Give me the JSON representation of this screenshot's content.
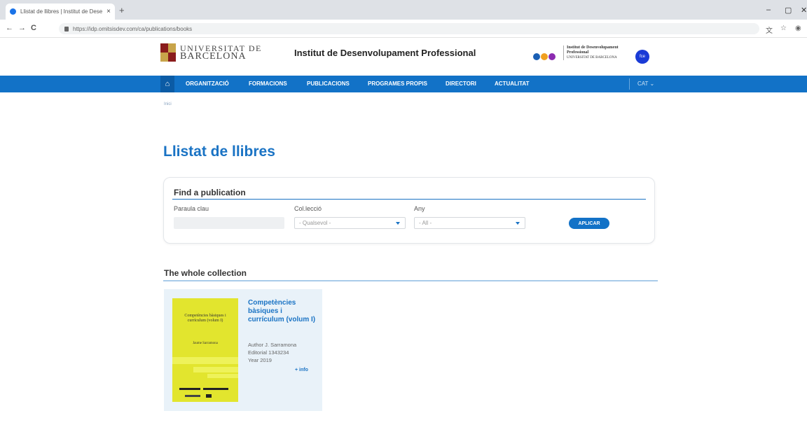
{
  "browser": {
    "tab_title": "Llistat de llibres | Institut de Dese",
    "tab_close": "×",
    "new_tab": "+",
    "url": "https://idp.omitsisdev.com/ca/publications/books",
    "controls": {
      "minimize": "–",
      "maximize": "▢",
      "close": "✕"
    },
    "nav": {
      "back": "←",
      "forward": "→",
      "reload": "C"
    }
  },
  "header": {
    "ub_line1": "UNIVERSITAT DE",
    "ub_line2": "BARCELONA",
    "site_title": "Institut de Desenvolupament Professional",
    "idp_line1": "Institut de Desenvolupament",
    "idp_line2": "Professional",
    "idp_line3": "UNIVERSITAT DE BARCELONA",
    "fce_label": "fce",
    "badge_colors": [
      "#1a5fb4",
      "#f0a020",
      "#8c2bb0"
    ]
  },
  "nav": {
    "home_icon": "⌂",
    "items": [
      "ORGANITZACIÓ",
      "FORMACIONS",
      "PUBLICACIONS",
      "PROGRAMES PROPIS",
      "DIRECTORI",
      "ACTUALITAT"
    ],
    "lang": "CAT ⌄"
  },
  "breadcrumb": "Inici",
  "page_title": "Llistat de llibres",
  "filters": {
    "title": "Find a publication",
    "keyword_label": "Paraula clau",
    "keyword_value": "",
    "collection_label": "Col.lecció",
    "collection_value": "- Qualsevol -",
    "year_label": "Any",
    "year_value": "- All -",
    "apply_label": "APLICAR"
  },
  "collection": {
    "title": "The whole collection",
    "books": [
      {
        "title": "Competències bàsiques i currículum (volum I)",
        "cover_title": "Competències bàsiques i currículum (volum I)",
        "cover_author": "Jaume Sarramona",
        "author": "Author J. Sarramona",
        "editorial": "Editorial 1343234",
        "year": "Year 2019",
        "more": "+ info"
      }
    ]
  },
  "colors": {
    "accent": "#1272c7",
    "title_blue": "#1a73c4",
    "card_bg": "#e9f2f9",
    "cover_yellow": "#e2e52e"
  }
}
